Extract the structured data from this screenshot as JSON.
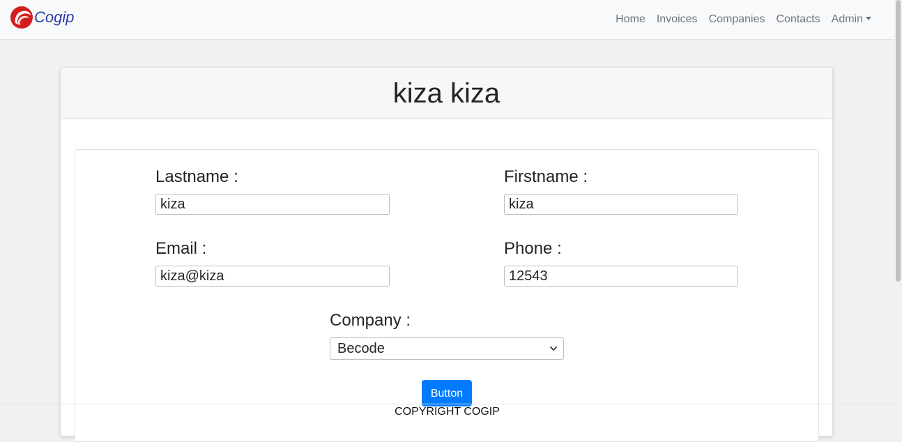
{
  "navbar": {
    "brand": "Cogip",
    "links": [
      "Home",
      "Invoices",
      "Companies",
      "Contacts",
      "Admin"
    ]
  },
  "card": {
    "title": "kiza kiza"
  },
  "form": {
    "lastname_label": "Lastname :",
    "lastname_value": "kiza",
    "firstname_label": "Firstname :",
    "firstname_value": "kiza",
    "email_label": "Email :",
    "email_value": "kiza@kiza",
    "phone_label": "Phone :",
    "phone_value": "12543",
    "company_label": "Company :",
    "company_selected": "Becode",
    "submit_label": "Button"
  },
  "footer": {
    "copyright": "COPYRIGHT COGIP"
  },
  "colors": {
    "brand_red": "#d41e1e",
    "brand_text": "#2a3ba8",
    "primary": "#007bff"
  }
}
